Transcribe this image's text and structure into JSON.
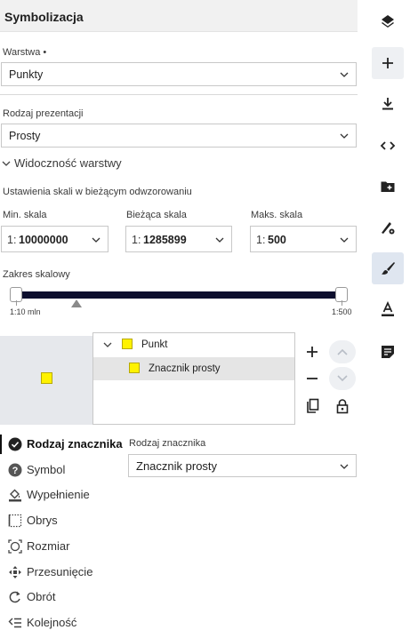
{
  "panel": {
    "title": "Symbolizacja",
    "layer_label": "Warstwa •",
    "layer_value": "Punkty",
    "presentation_label": "Rodzaj prezentacji",
    "presentation_value": "Prosty",
    "visibility_toggle": "Widoczność warstwy",
    "scale_settings_label": "Ustawienia skali w bieżącym odwzorowaniu",
    "min_scale": {
      "label": "Min. skala",
      "prefix": "1:",
      "value": "10000000"
    },
    "current_scale": {
      "label": "Bieżąca skala",
      "prefix": "1:",
      "value": "1285899"
    },
    "max_scale": {
      "label": "Maks. skala",
      "prefix": "1:",
      "value": "500"
    },
    "scale_range_label": "Zakres skalowy",
    "slider_min_caption": "1:10 mln",
    "slider_max_caption": "1:500"
  },
  "tree": {
    "items": [
      {
        "label": "Punkt",
        "expanded": true
      },
      {
        "label": "Znacznik prosty",
        "selected": true
      }
    ],
    "symbol_color": "#fff200"
  },
  "symbol_nav": {
    "items": [
      {
        "label": "Rodzaj znacznika",
        "icon": "check-circle-icon",
        "active": true
      },
      {
        "label": "Symbol",
        "icon": "help-circle-icon"
      },
      {
        "label": "Wypełnienie",
        "icon": "paint-bucket-icon"
      },
      {
        "label": "Obrys",
        "icon": "dotted-border-icon"
      },
      {
        "label": "Rozmiar",
        "icon": "resize-icon"
      },
      {
        "label": "Przesunięcie",
        "icon": "move-icon"
      },
      {
        "label": "Obrót",
        "icon": "rotate-icon"
      },
      {
        "label": "Kolejność",
        "icon": "order-list-icon"
      }
    ]
  },
  "marker_type": {
    "label": "Rodzaj znacznika",
    "value": "Znacznik prosty"
  },
  "right_toolbar": {
    "items": [
      "layers-icon",
      "plus-icon",
      "download-icon",
      "code-icon",
      "add-folder-icon",
      "style-settings-icon",
      "brush-icon",
      "text-color-icon",
      "notes-icon"
    ],
    "active": "brush-icon"
  }
}
